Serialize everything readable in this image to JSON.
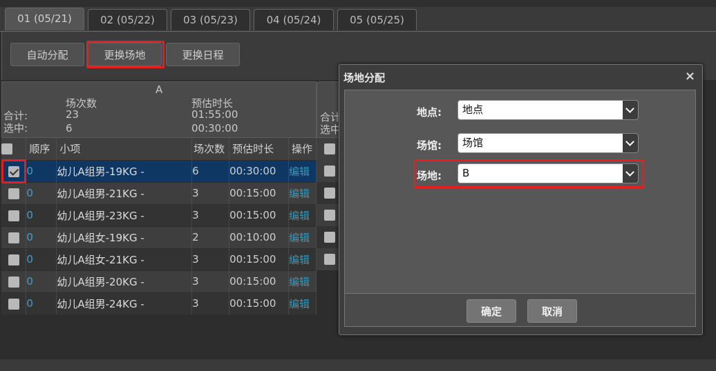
{
  "tabs": [
    {
      "label": "01 (05/21)"
    },
    {
      "label": "02 (05/22)"
    },
    {
      "label": "03 (05/23)"
    },
    {
      "label": "04 (05/24)"
    },
    {
      "label": "05 (05/25)"
    }
  ],
  "toolbar": {
    "auto_assign": "自动分配",
    "change_venue": "更换场地",
    "change_schedule": "更换日程"
  },
  "panel_a": {
    "title": "A",
    "col_sessions": "场次数",
    "col_duration": "预估时长",
    "total_label": "合计:",
    "selected_label": "选中:",
    "total_sessions": "23",
    "total_duration": "01:55:00",
    "selected_sessions": "6",
    "selected_duration": "00:30:00"
  },
  "grid_headers": {
    "order": "顺序",
    "item": "小项",
    "sessions": "场次数",
    "duration": "预估时长",
    "action": "操作"
  },
  "rows": [
    {
      "order": "0",
      "item": "幼儿A组男-19KG -",
      "sessions": "6",
      "duration": "00:30:00",
      "action": "编辑",
      "checked": true
    },
    {
      "order": "0",
      "item": "幼儿A组男-21KG -",
      "sessions": "3",
      "duration": "00:15:00",
      "action": "编辑",
      "checked": false
    },
    {
      "order": "0",
      "item": "幼儿A组男-23KG -",
      "sessions": "3",
      "duration": "00:15:00",
      "action": "编辑",
      "checked": false
    },
    {
      "order": "0",
      "item": "幼儿A组女-19KG -",
      "sessions": "2",
      "duration": "00:10:00",
      "action": "编辑",
      "checked": false
    },
    {
      "order": "0",
      "item": "幼儿A组女-21KG -",
      "sessions": "3",
      "duration": "00:15:00",
      "action": "编辑",
      "checked": false
    },
    {
      "order": "0",
      "item": "幼儿A组男-20KG -",
      "sessions": "3",
      "duration": "00:15:00",
      "action": "编辑",
      "checked": false
    },
    {
      "order": "0",
      "item": "幼儿A组男-24KG -",
      "sessions": "3",
      "duration": "00:15:00",
      "action": "编辑",
      "checked": false
    }
  ],
  "panel_b": {
    "total_label": "合计",
    "selected_label": "选中"
  },
  "modal": {
    "title": "场地分配",
    "close": "×",
    "location_label": "地点:",
    "location_value": "地点",
    "hall_label": "场馆:",
    "hall_value": "场馆",
    "venue_label": "场地:",
    "venue_value": "B",
    "confirm": "确定",
    "cancel": "取消"
  }
}
